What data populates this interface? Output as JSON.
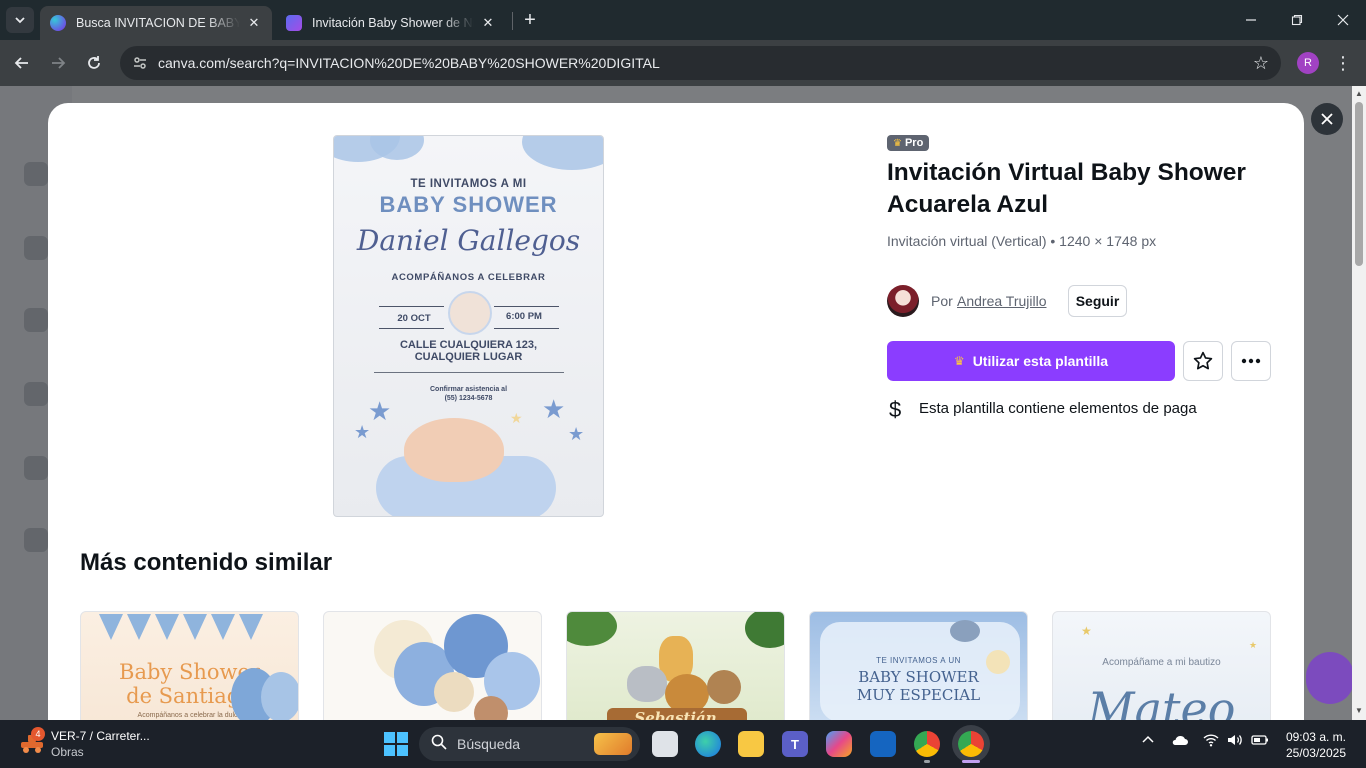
{
  "browser": {
    "tabs": [
      {
        "title": "Busca INVITACION DE BABY SHOWER",
        "active": true
      },
      {
        "title": "Invitación Baby Shower de Niño",
        "active": false
      }
    ],
    "url": "canva.com/search?q=INVITACION%20DE%20BABY%20SHOWER%20DIGITAL",
    "profile_initial": "R"
  },
  "modal": {
    "badge": "Pro",
    "title": "Invitación Virtual Baby Shower Acuarela Azul",
    "meta": "Invitación virtual (Vertical) • 1240 × 1748 px",
    "author": {
      "by": "Por",
      "name": "Andrea Trujillo",
      "follow_label": "Seguir"
    },
    "use_template_label": "Utilizar esta plantilla",
    "paid_notice": "Esta plantilla contiene elementos de paga",
    "preview": {
      "line1": "TE INVITAMOS A MI",
      "line2": "BABY SHOWER",
      "name": "Daniel Gallegos",
      "line3": "ACOMPÁÑANOS A CELEBRAR",
      "date": "20 OCT",
      "time": "6:00 PM",
      "address1": "CALLE CUALQUIERA 123,",
      "address2": "CUALQUIER LUGAR",
      "confirm": "Confirmar asistencia al",
      "phone": "(55) 1234-5678"
    },
    "similar_title": "Más contenido similar",
    "similar_cards": [
      {
        "line1": "Baby Shower",
        "line2": "de Santiago",
        "line3": "Acompáñanos a celebrar la dulce"
      },
      {},
      {
        "line1": "Sebastián"
      },
      {
        "line1": "TE INVITAMOS A UN",
        "line2": "BABY SHOWER",
        "line3": "MUY ESPECIAL"
      },
      {
        "line1": "Acompáñame a mi bautizo",
        "line2": "Mateo"
      }
    ]
  },
  "taskbar": {
    "weather_count": "4",
    "weather_title": "VER-7 / Carreter...",
    "weather_sub": "Obras",
    "search_label": "Búsqueda",
    "time": "09:03 a. m.",
    "date": "25/03/2025"
  },
  "colors": {
    "accent": "#8b3dff",
    "crown": "#ffc83d",
    "chrome_dark": "#202a2f"
  }
}
